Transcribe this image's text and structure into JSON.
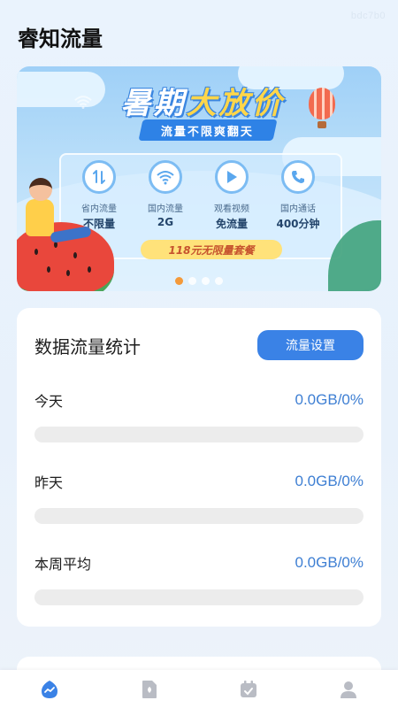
{
  "watermark": "bdc7b0",
  "app": {
    "title": "睿知流量"
  },
  "banner": {
    "headline_part1": "暑期",
    "headline_part2": "大放价",
    "subtitle": "流量不限爽翻天",
    "features": [
      {
        "icon": "swap-arrows-icon",
        "top": "省内流量",
        "bottom": "不限量"
      },
      {
        "icon": "wifi-icon",
        "top": "国内流量",
        "bottom": "2G"
      },
      {
        "icon": "play-icon",
        "top": "观看视频",
        "bottom": "免流量"
      },
      {
        "icon": "phone-icon",
        "top": "国内通话",
        "bottom": "400分钟"
      }
    ],
    "package_tag": "118元无限量套餐",
    "carousel": {
      "count": 4,
      "active_index": 0
    }
  },
  "stats": {
    "title": "数据流量统计",
    "settings_button": "流量设置",
    "rows": [
      {
        "label": "今天",
        "value": "0.0GB/0%",
        "percent": 0
      },
      {
        "label": "昨天",
        "value": "0.0GB/0%",
        "percent": 0
      },
      {
        "label": "本周平均",
        "value": "0.0GB/0%",
        "percent": 0
      }
    ]
  },
  "bottom_nav": {
    "items": [
      {
        "icon": "home-stats-icon",
        "active": true
      },
      {
        "icon": "sim-card-icon",
        "active": false
      },
      {
        "icon": "calendar-icon",
        "active": false
      },
      {
        "icon": "profile-icon",
        "active": false
      }
    ]
  },
  "colors": {
    "accent": "#3a82e6",
    "value_text": "#3e7fd3",
    "track": "#ececec",
    "page_bg": "#eaf3fd",
    "nav_inactive": "#b9bcc4"
  }
}
